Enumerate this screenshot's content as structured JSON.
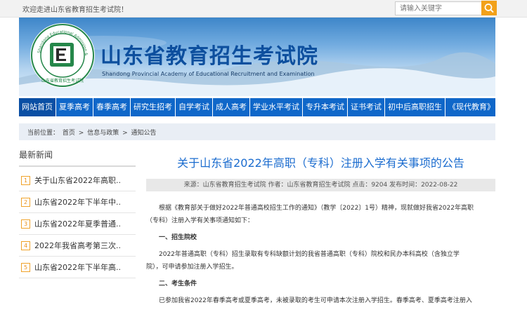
{
  "topbar": {
    "welcome": "欢迎走进山东省教育招生考试院！",
    "search_placeholder": "请输入关键字"
  },
  "header": {
    "logo_ring_text": "Shandong Educational Admission & Examination",
    "logo_bottom_text": "山东省教育招生考试院",
    "title": "山东省教育招生考试院",
    "subtitle": "Shandong Provincial Academy of Educational Recruitment and Examination"
  },
  "nav": {
    "items": [
      "网站首页",
      "夏季高考",
      "春季高考",
      "研究生招考",
      "自学考试",
      "成人高考",
      "学业水平考试",
      "专升本考试",
      "证书考试",
      "初中后高职招生",
      "《现代教育》"
    ]
  },
  "breadcrumb": {
    "prefix": "当前位置：",
    "items": [
      "首页",
      "信息与政策",
      "通知公告"
    ]
  },
  "sidebar": {
    "title": "最新新闻",
    "items": [
      {
        "num": "1",
        "text": "关于山东省2022年高职.."
      },
      {
        "num": "2",
        "text": "山东省2022年下半年中.."
      },
      {
        "num": "3",
        "text": "山东省2022年夏季普通.."
      },
      {
        "num": "4",
        "text": "2022年我省高考第三次.."
      },
      {
        "num": "5",
        "text": "山东省2022年下半年高.."
      }
    ]
  },
  "article": {
    "title": "关于山东省2022年高职（专科）注册入学有关事项的公告",
    "meta": "来源：山东省教育招生考试院 作者：山东省教育招生考试院 点击：9204 发布时间：2022-08-22",
    "p1_line1": "根据《教育部关于做好2022年普通高校招生工作的通知》（教学〔2022〕1号）精神，现就做好我省2022年高职",
    "p1_line2": "（专科）注册入学有关事项通知如下：",
    "h1": "一、招生院校",
    "p2_line1": "2022年普通高职（专科）招生录取有专科缺额计划的我省普通高职（专科）院校和民办本科高校（含独立学",
    "p2_line2": "院），可申请参加注册入学招生。",
    "h2": "二、考生条件",
    "p3_line1": "已参加我省2022年春季高考或夏季高考，未被录取的考生可申请本次注册入学招生。春季高考、夏季高考注册入"
  },
  "colors": {
    "nav_bg": "#0f67c9",
    "title_blue": "#1b6ccf",
    "accent_orange": "#f2a11a"
  }
}
